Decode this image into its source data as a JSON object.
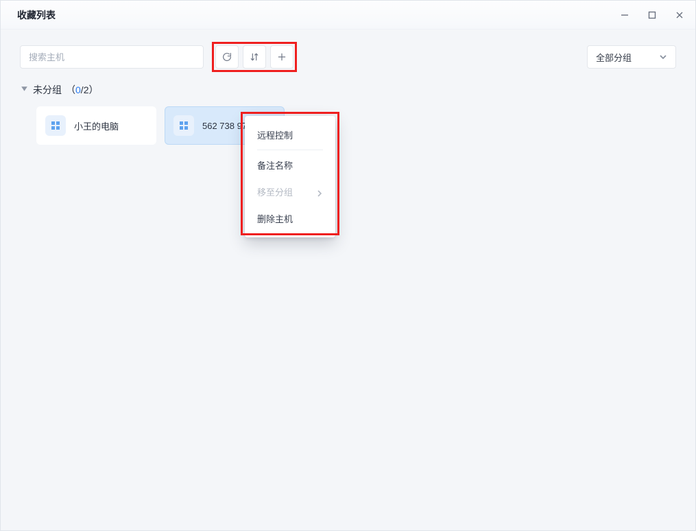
{
  "window": {
    "title": "收藏列表"
  },
  "toolbar": {
    "search_placeholder": "搜索主机",
    "group_select_label": "全部分组"
  },
  "group": {
    "name": "未分组",
    "count_prefix": "（",
    "online": "0",
    "slash": "/",
    "total": "2",
    "count_suffix": "）"
  },
  "hosts": [
    {
      "name": "小王的电脑"
    },
    {
      "name": "562 738 971"
    }
  ],
  "context_menu": {
    "remote_control": "远程控制",
    "rename": "备注名称",
    "move_to_group": "移至分组",
    "delete_host": "删除主机"
  }
}
